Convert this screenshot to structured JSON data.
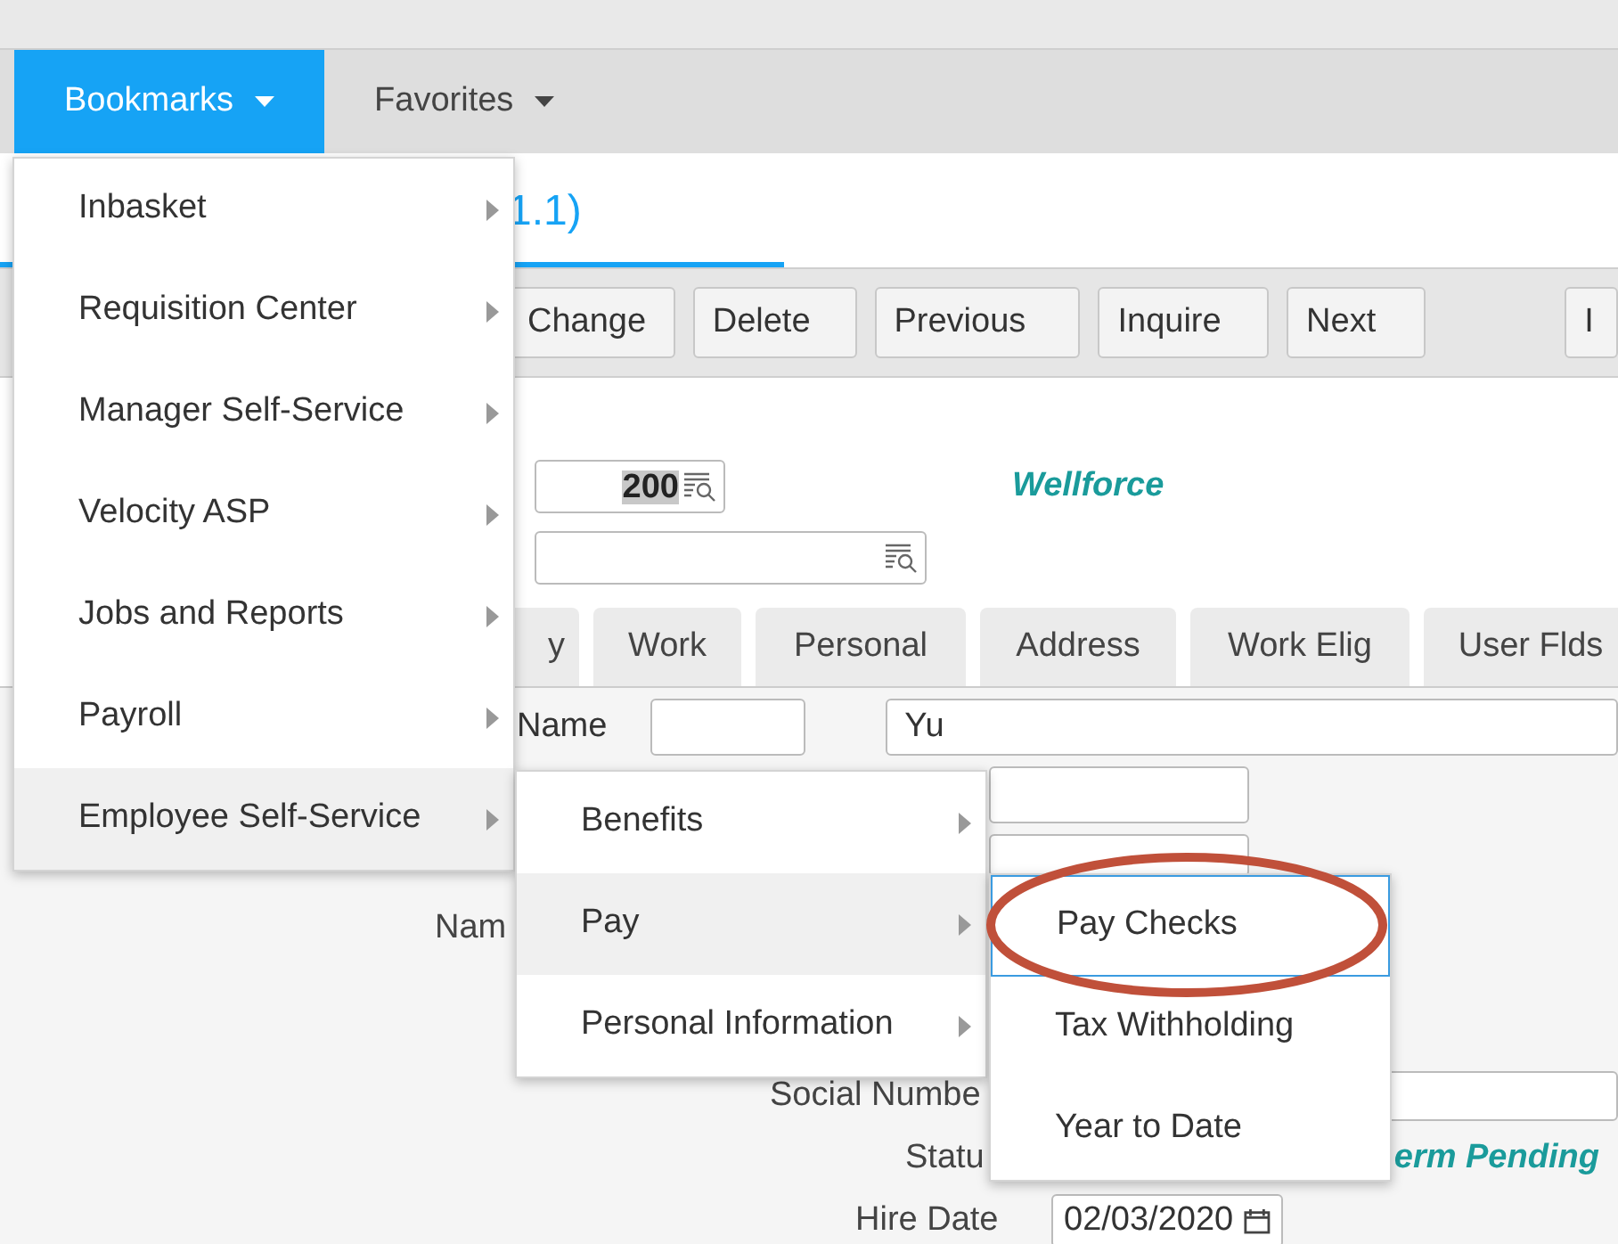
{
  "nav": [
    {
      "label": "Bookmarks",
      "selected": true
    },
    {
      "label": "Favorites",
      "selected": false
    }
  ],
  "page_title": "1.1)",
  "toolbar": [
    "Change",
    "Delete",
    "Previous",
    "Inquire",
    "Next",
    "I"
  ],
  "header": {
    "company_field": "200",
    "company_name": "Wellforce"
  },
  "tabs": [
    "y",
    "Work",
    "Personal",
    "Address",
    "Work Elig",
    "User Flds"
  ],
  "form": {
    "name_label": "Name",
    "last_name": "Yu",
    "name_label_2": "Nam",
    "social_label": "Social Numbe",
    "status_label": "Statu",
    "status_text": "erm Pending",
    "hire_label": "Hire Date",
    "hire_date": "02/03/2020"
  },
  "menus": [
    {
      "items": [
        {
          "label": "Inbasket",
          "selected": false,
          "has_submenu": true
        },
        {
          "label": "Requisition Center",
          "selected": false,
          "has_submenu": true
        },
        {
          "label": "Manager Self-Service",
          "selected": false,
          "has_submenu": true
        },
        {
          "label": "Velocity ASP",
          "selected": false,
          "has_submenu": true
        },
        {
          "label": "Jobs and Reports",
          "selected": false,
          "has_submenu": true
        },
        {
          "label": "Payroll",
          "selected": false,
          "has_submenu": true
        },
        {
          "label": "Employee Self-Service",
          "selected": true,
          "has_submenu": true
        }
      ]
    },
    {
      "items": [
        {
          "label": "Benefits",
          "selected": false,
          "has_submenu": true
        },
        {
          "label": "Pay",
          "selected": true,
          "has_submenu": true
        },
        {
          "label": "Personal Information",
          "selected": false,
          "has_submenu": true
        }
      ]
    },
    {
      "items": [
        {
          "label": "Pay Checks",
          "selected": true,
          "has_submenu": false
        },
        {
          "label": "Tax Withholding",
          "selected": false,
          "has_submenu": false
        },
        {
          "label": "Year to Date",
          "selected": false,
          "has_submenu": false
        }
      ]
    }
  ]
}
